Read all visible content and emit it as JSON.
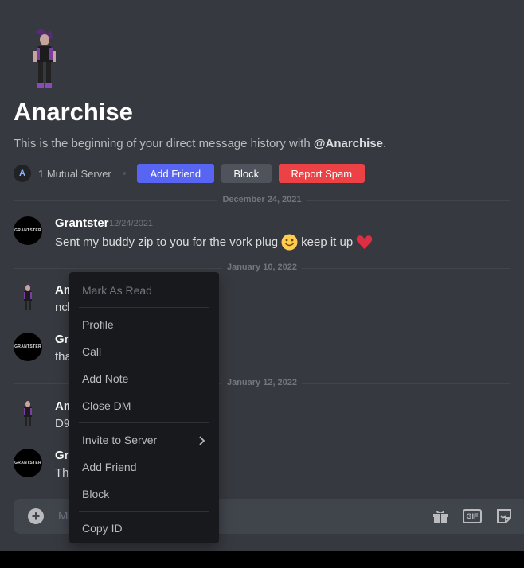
{
  "profile": {
    "name": "Anarchise",
    "history_prefix": "This is the beginning of your direct message history with ",
    "history_handle": "@Anarchise",
    "history_suffix": ".",
    "mutual_initial": "A",
    "mutual_text": "1 Mutual Server",
    "add_friend_label": "Add Friend",
    "block_label": "Block",
    "report_label": "Report Spam"
  },
  "dividers": [
    "December 24, 2021",
    "January 10, 2022",
    "January 12, 2022"
  ],
  "messages": [
    {
      "author": "Grantster",
      "time": "12/24/2021",
      "text_a": "Sent my buddy zip to you for the vork plug",
      "text_b": "keep it up",
      "avatar_text": "GRANTSTER"
    },
    {
      "author": "An",
      "text": "nck"
    },
    {
      "author": "Gra",
      "text": "tha",
      "avatar_text": "GRANTSTER"
    },
    {
      "author": "An",
      "text": "D9"
    },
    {
      "author": "Gra",
      "text": "Tha",
      "avatar_text": "GRANTSTER"
    }
  ],
  "composer": {
    "placeholder": "M",
    "plus_glyph": "+",
    "gif_label": "GIF"
  },
  "context_menu": {
    "items": [
      "Mark As Read",
      "Profile",
      "Call",
      "Add Note",
      "Close DM",
      "Invite to Server",
      "Add Friend",
      "Block",
      "Copy ID"
    ]
  },
  "colors": {
    "background": "#36393f",
    "blurple": "#5865f2",
    "danger": "#ed4245",
    "menu_bg": "#18191c"
  },
  "icons": [
    "user-avatar",
    "gift-icon",
    "gif-icon",
    "sticker-icon",
    "plus-icon",
    "chevron-right-icon",
    "smile-emoji",
    "heart-emoji"
  ]
}
